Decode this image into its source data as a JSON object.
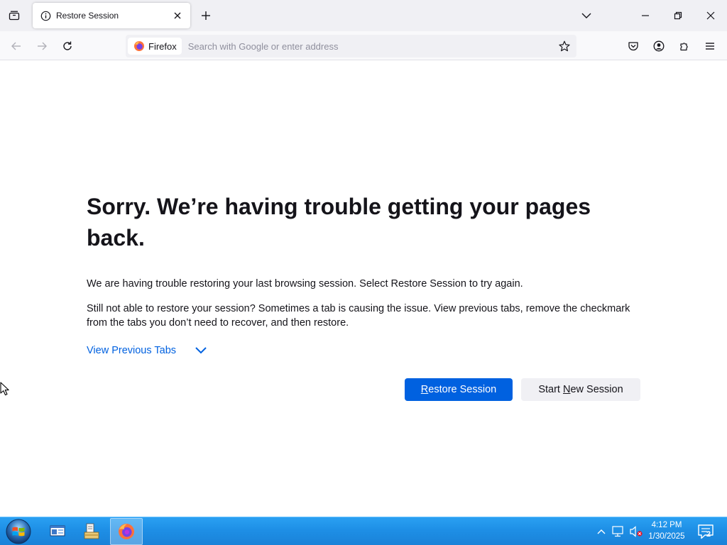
{
  "tab": {
    "title": "Restore Session"
  },
  "urlbar": {
    "identity_label": "Firefox",
    "placeholder": "Search with Google or enter address",
    "value": ""
  },
  "content": {
    "heading": "Sorry. We’re having trouble getting your pages back.",
    "para1": "We are having trouble restoring your last browsing session. Select Restore Session to try again.",
    "para2": "Still not able to restore your session? Sometimes a tab is causing the issue. View previous tabs, remove the checkmark from the tabs you don’t need to recover, and then restore.",
    "view_previous_tabs": "View Previous Tabs",
    "restore_button": {
      "accesskey_char": "R",
      "rest": "estore Session"
    },
    "new_session_button": {
      "before": "Start ",
      "accesskey_char": "N",
      "after": "ew Session"
    }
  },
  "taskbar": {
    "clock_time": "4:12 PM",
    "clock_date": "1/30/2025",
    "notification_count": "2"
  },
  "colors": {
    "accent": "#0061e0",
    "tabstrip_bg": "#f0f0f4",
    "taskbar_bg": "#1e8fe6"
  },
  "icons": {
    "tab_list": "tab-list-icon",
    "tab_info": "info-icon",
    "close": "close-icon",
    "new_tab": "plus-icon",
    "back": "back-arrow-icon",
    "forward": "forward-arrow-icon",
    "reload": "reload-icon",
    "firefox": "firefox-icon",
    "bookmark": "star-icon",
    "pocket": "pocket-icon",
    "account": "account-icon",
    "extensions": "puzzle-icon",
    "menu": "hamburger-icon"
  }
}
